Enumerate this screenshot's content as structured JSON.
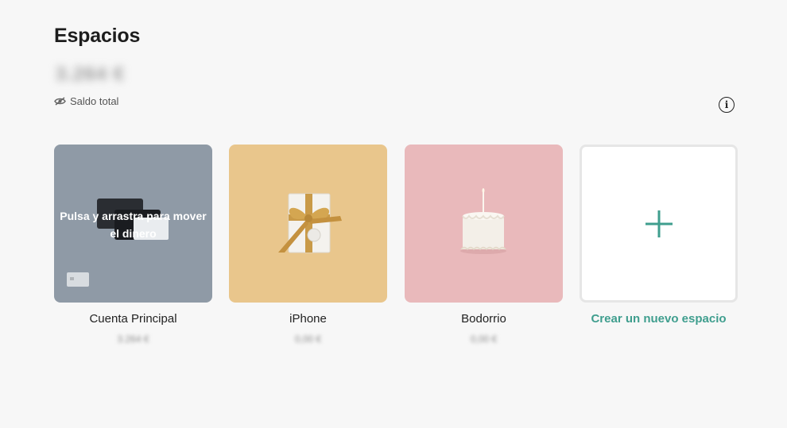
{
  "header": {
    "title": "Espacios",
    "balance": "3.264 €",
    "balance_label": "Saldo total"
  },
  "icons": {
    "visibility": "eye-off-icon",
    "info": "info-icon",
    "add": "plus-icon"
  },
  "colors": {
    "accent": "#3f9e8e",
    "main_tile": "#8f9aa6",
    "iphone_tile": "#e9c68c",
    "boda_tile": "#e9b9bb"
  },
  "spaces": [
    {
      "name": "Cuenta Principal",
      "amount": "3.264 €",
      "hint": "Pulsa y arrastra para mover el dinero"
    },
    {
      "name": "iPhone",
      "amount": "0,00 €"
    },
    {
      "name": "Bodorrio",
      "amount": "0,00 €"
    }
  ],
  "new_space": {
    "label": "Crear un nuevo espacio"
  }
}
